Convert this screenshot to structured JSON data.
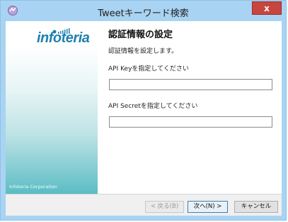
{
  "window": {
    "title": "Tweetキーワード検索",
    "close_label": "x"
  },
  "sidebar": {
    "logo_text": "infoteria",
    "copyright": "Infoteria Corporation"
  },
  "main": {
    "heading": "認証情報の設定",
    "description": "認証情報を設定します。",
    "api_key": {
      "label": "API Keyを指定してください",
      "value": ""
    },
    "api_secret": {
      "label": "API Secretを指定してください",
      "value": ""
    }
  },
  "buttons": {
    "back": "< 戻る(B)",
    "next": "次へ(N) >",
    "cancel": "キャンセル"
  },
  "colors": {
    "title_bar": "#a9d3f2",
    "close": "#c7463f",
    "logo": "#1f7fae",
    "accent_teal": "#5bbdc4"
  }
}
